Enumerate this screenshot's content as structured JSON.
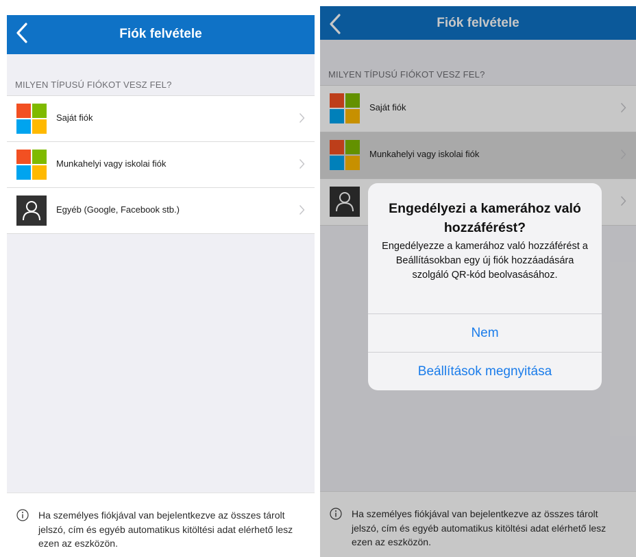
{
  "left_screen": {
    "nav_title": "Fiók felvétele",
    "section_header": "MILYEN TÍPUSÚ FIÓKOT VESZ FEL?",
    "items": [
      {
        "label": "Saját fiók"
      },
      {
        "label": "Munkahelyi vagy iskolai fiók"
      },
      {
        "label": "Egyéb (Google, Facebook stb.)"
      }
    ],
    "footer_text": "Ha személyes fiókjával van bejelentkezve az összes tárolt jelszó, cím és egyéb automatikus kitöltési adat elérhető lesz ezen az eszközön."
  },
  "right_screen": {
    "nav_title": "Fiók felvétele",
    "section_header": "MILYEN TÍPUSÚ FIÓKOT VESZ FEL?",
    "items": [
      {
        "label": "Saját fiók"
      },
      {
        "label": "Munkahelyi vagy iskolai fiók"
      },
      {
        "label": ""
      }
    ],
    "footer_text": "Ha személyes fiókjával van bejelentkezve az összes tárolt jelszó, cím és egyéb automatikus kitöltési adat elérhető lesz ezen az eszközön.",
    "alert": {
      "title": "Engedélyezi a kamerához való hozzáférést?",
      "message": "Engedélyezze a kamerához való hozzáférést a Beállításokban egy új fiók hozzáadására szolgáló QR-kód beolvasásához.",
      "button_no": "Nem",
      "button_settings": "Beállítások megnyitása"
    }
  },
  "colors": {
    "nav_blue": "#0f72c6",
    "ms_red": "#f25022",
    "ms_green": "#7fba00",
    "ms_blue": "#00a4ef",
    "ms_yellow": "#ffb900",
    "ios_link_blue": "#1a7cea"
  },
  "icons": {
    "back": "chevron-left-icon",
    "microsoft": "microsoft-logo-icon",
    "other_account": "person-icon",
    "row_chevron": "chevron-right-icon",
    "info": "info-icon"
  }
}
